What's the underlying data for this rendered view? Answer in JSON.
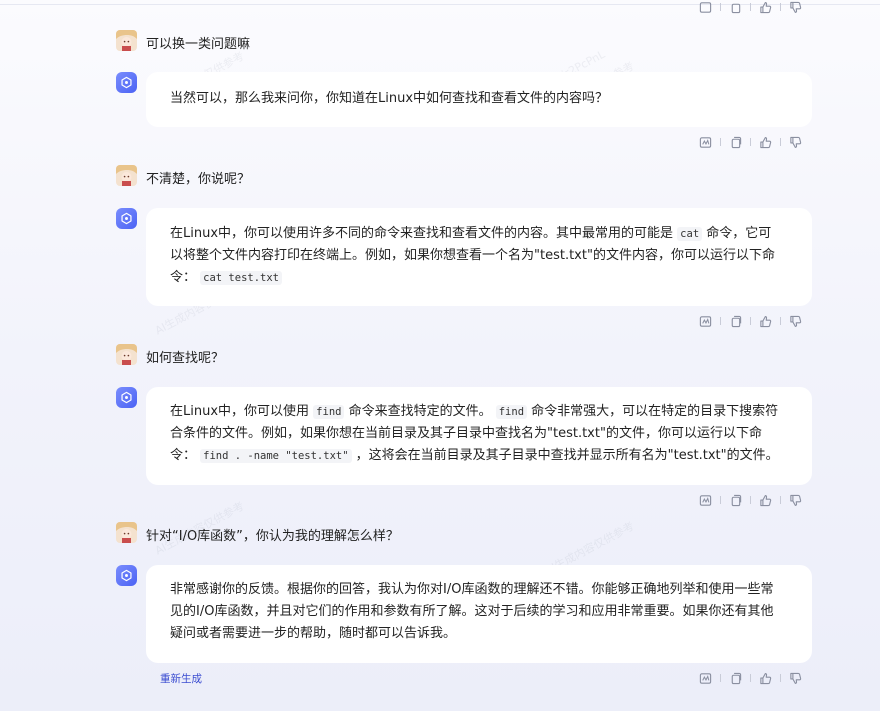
{
  "conversation": [
    {
      "role": "user",
      "text": "可以换一类问题嘛"
    },
    {
      "role": "assistant",
      "parts": [
        {
          "t": "text",
          "v": "当然可以，那么我来问你，你知道在Linux中如何查找和查看文件的内容吗？"
        }
      ]
    },
    {
      "role": "user",
      "text": "不清楚，你说呢？"
    },
    {
      "role": "assistant",
      "parts": [
        {
          "t": "text",
          "v": "在Linux中，你可以使用许多不同的命令来查找和查看文件的内容。其中最常用的可能是 "
        },
        {
          "t": "code",
          "v": "cat"
        },
        {
          "t": "text",
          "v": " 命令，它可以将整个文件内容打印在终端上。例如，如果你想查看一个名为\"test.txt\"的文件内容，你可以运行以下命令： "
        },
        {
          "t": "code",
          "v": "cat test.txt"
        }
      ]
    },
    {
      "role": "user",
      "text": "如何查找呢？"
    },
    {
      "role": "assistant",
      "parts": [
        {
          "t": "text",
          "v": "在Linux中，你可以使用 "
        },
        {
          "t": "code",
          "v": "find"
        },
        {
          "t": "text",
          "v": " 命令来查找特定的文件。 "
        },
        {
          "t": "code",
          "v": "find"
        },
        {
          "t": "text",
          "v": " 命令非常强大，可以在特定的目录下搜索符合条件的文件。例如，如果你想在当前目录及其子目录中查找名为\"test.txt\"的文件，你可以运行以下命令： "
        },
        {
          "t": "code",
          "v": "find . -name \"test.txt\""
        },
        {
          "t": "text",
          "v": " ，这将会在当前目录及其子目录中查找并显示所有名为\"test.txt\"的文件。"
        }
      ]
    },
    {
      "role": "user",
      "text": "针对“I/O库函数”，你认为我的理解怎么样？"
    },
    {
      "role": "assistant",
      "parts": [
        {
          "t": "text",
          "v": "非常感谢你的反馈。根据你的回答，我认为你对I/O库函数的理解还不错。你能够正确地列举和使用一些常见的I/O库函数，并且对它们的作用和参数有所了解。这对于后续的学习和应用非常重要。如果你还有其他疑问或者需要进一步的帮助，随时都可以告诉我。"
        }
      ]
    }
  ],
  "regenerate_label": "重新生成",
  "action_icons": [
    "report-icon",
    "copy-icon",
    "thumbs-up-icon",
    "thumbs-down-icon"
  ],
  "watermark": "AI生成内容仅供参考",
  "watermark_id": "jr2PcPnL",
  "colors": {
    "accent": "#4b63f4",
    "link": "#3c4dd1",
    "bubble": "#ffffff"
  }
}
